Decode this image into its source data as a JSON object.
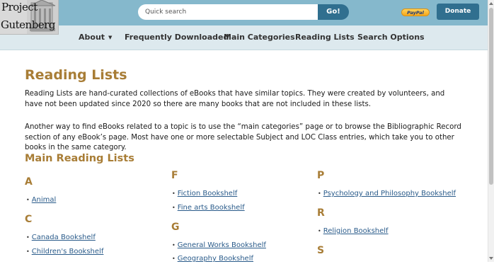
{
  "header": {
    "logo": {
      "line1": "Project",
      "line2": "Gutenberg"
    },
    "search": {
      "placeholder": "Quick search",
      "value": "",
      "button_label": "Go!"
    },
    "paypal_label": "PayPal",
    "donate_label": "Donate",
    "accent_color": "#306f8f",
    "bar_color": "#85b8cc"
  },
  "nav": {
    "items": [
      {
        "label": "About",
        "has_dropdown": true
      },
      {
        "label": "Frequently Downloaded"
      },
      {
        "label": "Main Categories"
      },
      {
        "label": "Reading Lists"
      },
      {
        "label": "Search Options"
      }
    ],
    "dropdown_caret": "▼"
  },
  "main": {
    "title": "Reading Lists",
    "paragraph1": "Reading Lists are hand-curated collections of eBooks that have similar topics. They were created by volunteers, and have not been updated since 2020 so there are many books that are not included in these lists.",
    "paragraph2": "Another way to find eBooks related to a topic is to use the “main categories” page or to browse the Bibliographic Record section of any eBook’s page. Most have one or more selectable Subject and LOC Class entries, which take you to other books in the same category.",
    "section_title": "Main Reading Lists",
    "columns": [
      {
        "groups": [
          {
            "letter": "A",
            "items": [
              "Animal"
            ]
          },
          {
            "letter": "C",
            "items": [
              "Canada Bookshelf",
              "Children's Bookshelf"
            ]
          }
        ]
      },
      {
        "groups": [
          {
            "letter": "F",
            "items": [
              "Fiction Bookshelf",
              "Fine arts Bookshelf"
            ]
          },
          {
            "letter": "G",
            "items": [
              "General Works Bookshelf",
              "Geography Bookshelf"
            ]
          }
        ]
      },
      {
        "groups": [
          {
            "letter": "P",
            "items": [
              "Psychology and Philosophy Bookshelf"
            ]
          },
          {
            "letter": "R",
            "items": [
              "Religion Bookshelf"
            ]
          },
          {
            "letter": "S",
            "items": []
          }
        ]
      }
    ],
    "heading_color": "#a87d36",
    "link_color": "#2a5b8a"
  },
  "bullet": "•"
}
